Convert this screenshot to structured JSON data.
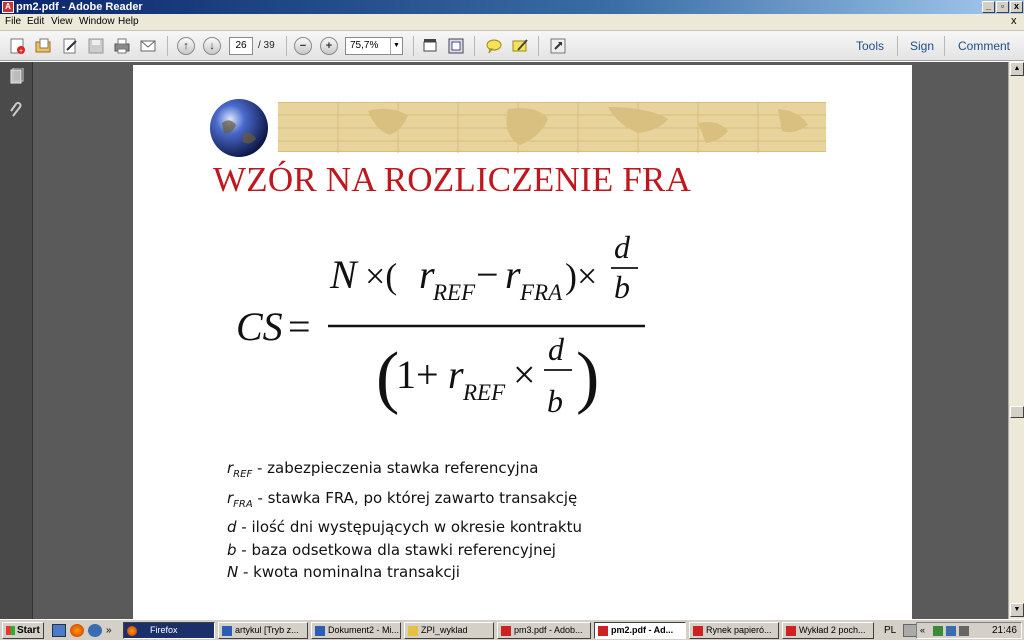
{
  "window": {
    "title": "pm2.pdf - Adobe Reader",
    "controls": {
      "minimize": "_",
      "restore": "▫",
      "close": "x"
    }
  },
  "menu": {
    "items": [
      "File",
      "Edit",
      "View",
      "Window",
      "Help"
    ],
    "right_close": "x"
  },
  "toolbar": {
    "page_current": "26",
    "page_total": "/ 39",
    "zoom": "75,7%",
    "links": [
      "Tools",
      "Sign",
      "Comment"
    ]
  },
  "slide": {
    "title": "WZÓR NA ROZLICZENIE FRA",
    "formula": {
      "lhs": "CS =",
      "numerator": "N×(r_REF − r_FRA)×d/b",
      "denominator": "(1 + r_REF × d/b)"
    },
    "definitions": [
      {
        "symbol": "r",
        "sub": "REF",
        "text": " - zabezpieczenia stawka referencyjna"
      },
      {
        "symbol": "r",
        "sub": "FRA",
        "text": " - stawka FRA, po której zawarto transakcję"
      },
      {
        "symbol": "d",
        "sub": "",
        "text": " - ilość dni występujących w okresie kontraktu"
      },
      {
        "symbol": "b",
        "sub": "",
        "text": " - baza odsetkowa dla stawki referencyjnej"
      },
      {
        "symbol": "N",
        "sub": "",
        "text": " - kwota nominalna transakcji"
      }
    ]
  },
  "taskbar": {
    "start": "Start",
    "tasks": [
      {
        "label": "Firefox",
        "state": "dark"
      },
      {
        "label": "artykul [Tryb z...",
        "state": "normal"
      },
      {
        "label": "Dokument2 - Mi...",
        "state": "normal"
      },
      {
        "label": "ZPI_wyklad",
        "state": "normal"
      },
      {
        "label": "pm3.pdf - Adob...",
        "state": "normal"
      },
      {
        "label": "pm2.pdf - Ad...",
        "state": "active"
      },
      {
        "label": "Rynek papieró...",
        "state": "normal"
      },
      {
        "label": "Wykład 2 poch...",
        "state": "normal"
      }
    ],
    "language": "PL",
    "time": "21:46"
  },
  "colors": {
    "title_red": "#c0161e",
    "titlebar_blue": "#0a246a",
    "doc_background": "#5a5a5a",
    "link_blue": "#1f4f8a"
  }
}
